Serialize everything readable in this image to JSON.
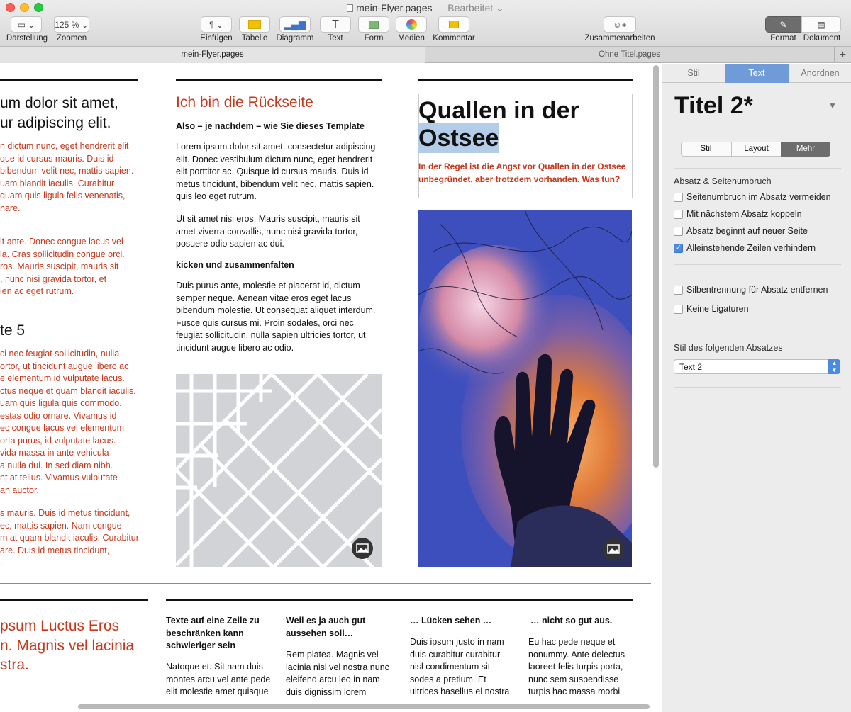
{
  "window": {
    "title": "mein-Flyer.pages",
    "status": "— Bearbeitet"
  },
  "toolbar": {
    "view_label": "Darstellung",
    "zoom_value": "125 %",
    "zoom_label": "Zoomen",
    "insert_label": "Einfügen",
    "table_label": "Tabelle",
    "chart_label": "Diagramm",
    "text_label": "Text",
    "shape_label": "Form",
    "media_label": "Medien",
    "comment_label": "Kommentar",
    "collab_label": "Zusammenarbeiten",
    "format_label": "Format",
    "document_label": "Dokument"
  },
  "tabs": {
    "tab1": "mein-Flyer.pages",
    "tab2": "Ohne Titel.pages",
    "add": "+"
  },
  "doc": {
    "col1": {
      "heading": "um dolor sit amet,\nur adipiscing elit.",
      "p1": "n dictum nunc, eget hendrerit elit\nque id cursus mauris. Duis id\nbibendum velit nec, mattis sapien.\nuam blandit iaculis. Curabitur\nquam quis ligula felis venenatis,\nnare.",
      "p2": "it ante. Donec congue lacus vel\nla. Cras sollicitudin congue orci.\nros. Mauris suscipit, mauris sit\n, nunc nisi gravida tortor, et\nien ac eget rutrum.",
      "subhead": "te 5",
      "p3": "ci nec feugiat sollicitudin, nulla\nortor, ut tincidunt augue libero ac\ne elementum id vulputate lacus.\nctus neque et quam blandit iaculis.\nuam quis ligula quis commodo.\nestas odio ornare. Vivamus id\nec congue lacus vel elementum\norta purus, id vulputate lacus.\nvida massa in ante vehicula\na nulla dui. In sed diam nibh.\nnt at tellus. Vivamus vulputate\nan auctor.",
      "p4": "s mauris. Duis id metus tincidunt,\nec, mattis sapien. Nam congue\nm at quam blandit iaculis. Curabitur\nare. Duis id metus tincidunt,\n."
    },
    "col2": {
      "heading": "Ich bin die Rückseite",
      "subhead": "Also – je nachdem – wie Sie dieses Template",
      "p1": "Lorem ipsum dolor sit amet, consectetur adipiscing\nelit. Donec vestibulum dictum nunc, eget hendrerit\nelit porttitor ac. Quisque id cursus mauris. Duis id\nmetus tincidunt, bibendum velit nec, mattis sapien.\nquis leo eget rutrum.",
      "p2": "Ut sit amet nisi eros. Mauris suscipit, mauris sit\namet viverra convallis, nunc nisi gravida tortor,\nposuere odio sapien ac dui.",
      "subhead2": "kicken und zusammenfalten",
      "p3": "Duis purus ante, molestie et placerat id, dictum\nsemper neque. Aenean vitae eros eget lacus\nbibendum molestie. Ut consequat aliquet interdum.\nFusce quis cursus mi. Proin sodales, orci nec\nfeugiat sollicitudin, nulla sapien ultricies tortor, ut\ntincidunt augue libero ac odio."
    },
    "col3": {
      "title_line1": "Quallen in der",
      "title_line2": "Ostsee",
      "lead": "In der Regel ist die Angst vor Quallen in der Ostsee\nunbegründet, aber trotzdem vorhanden. Was tun?"
    },
    "page2": {
      "red_heading": "psum Luctus Eros\nn. Magnis vel lacinia\nstra.",
      "c1_head": "Texte auf eine Zeile zu\nbeschränken kann\nschwieriger sein",
      "c1_text": "Natoque et. Sit nam duis\nmontes arcu vel ante pede\nelit molestie amet quisque",
      "c2_head": "Weil es ja auch gut\naussehen soll…",
      "c2_text": "Rem platea. Magnis vel\nlacinia nisl vel nostra nunc\neleifend arcu leo in nam\nduis dignissim lorem",
      "c3_head": "… Lücken sehen …",
      "c3_text": "Duis ipsum justo in nam\nduis curabitur curabitur\nnisl condimentum sit\nsodes a pretium. Et\nultrices hasellus el nostra",
      "c4_head": "… nicht so gut aus.",
      "c4_text": "Eu hac pede neque et\nnonummy. Ante delectus\nlaoreet felis turpis porta,\nnunc sem suspendisse\nturpis hac massa morbi"
    }
  },
  "panel": {
    "tab_style": "Stil",
    "tab_text": "Text",
    "tab_arrange": "Anordnen",
    "style_name": "Titel 2*",
    "seg_style": "Stil",
    "seg_layout": "Layout",
    "seg_more": "Mehr",
    "section1": "Absatz & Seitenumbruch",
    "opt1": "Seitenumbruch im Absatz vermeiden",
    "opt2": "Mit nächstem Absatz koppeln",
    "opt3": "Absatz beginnt auf neuer Seite",
    "opt4": "Alleinstehende Zeilen verhindern",
    "opt5": "Silbentrennung für Absatz entfernen",
    "opt6": "Keine Ligaturen",
    "section2": "Stil des folgenden Absatzes",
    "next_style": "Text 2"
  },
  "colors": {
    "accent": "#c7371b",
    "selected_tab": "#6f9bd8"
  }
}
